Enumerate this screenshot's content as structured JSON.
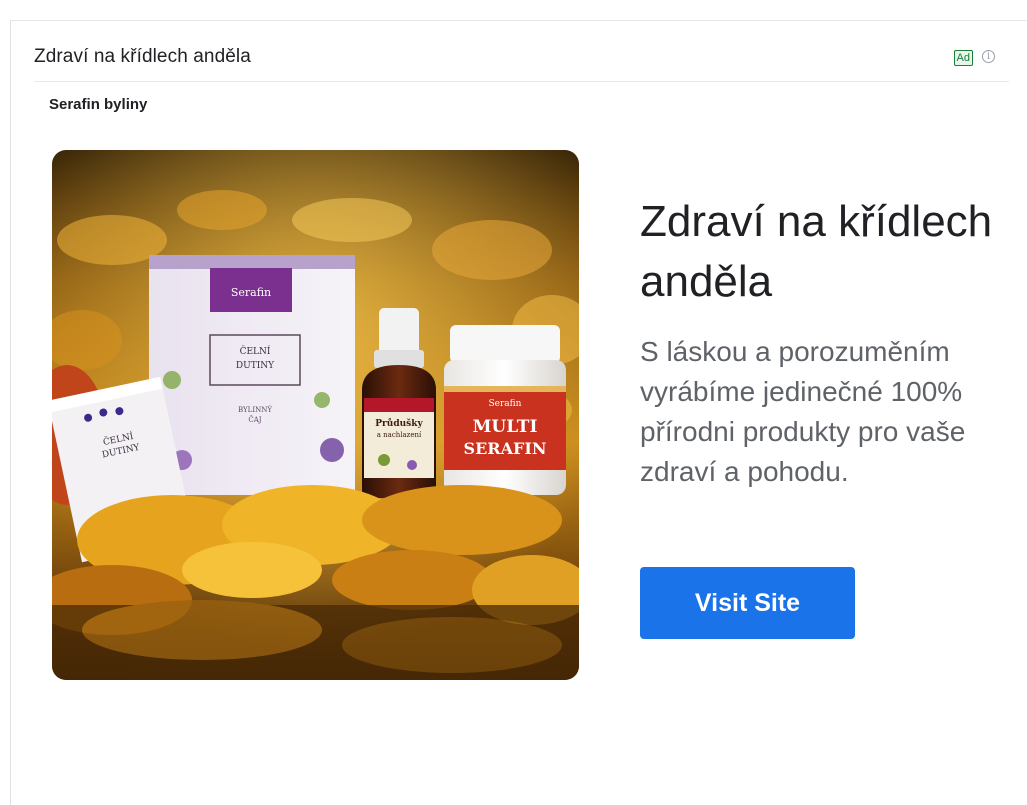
{
  "ad": {
    "header_title": "Zdraví na křídlech anděla",
    "badge": "Ad",
    "info_icon": "info-icon",
    "advertiser": "Serafin byliny",
    "headline": "Zdraví na křídlech anděla",
    "description": "S láskou a porozuměním vyrábíme jedinečné 100% přírodni produkty pro vaše zdraví a pohodu.",
    "cta_label": "Visit Site",
    "cta_color": "#1a73e8"
  },
  "product_image": {
    "packages": [
      {
        "brand": "Serafin",
        "label": "ČELNÍ DUTINY",
        "sub": "BYLINNÝ ČAJ"
      },
      {
        "label": "ČELNÍ DUTINY"
      },
      {
        "label": "Průdušky a nachlazení"
      },
      {
        "label": "MULTI SERAFIN"
      }
    ]
  }
}
